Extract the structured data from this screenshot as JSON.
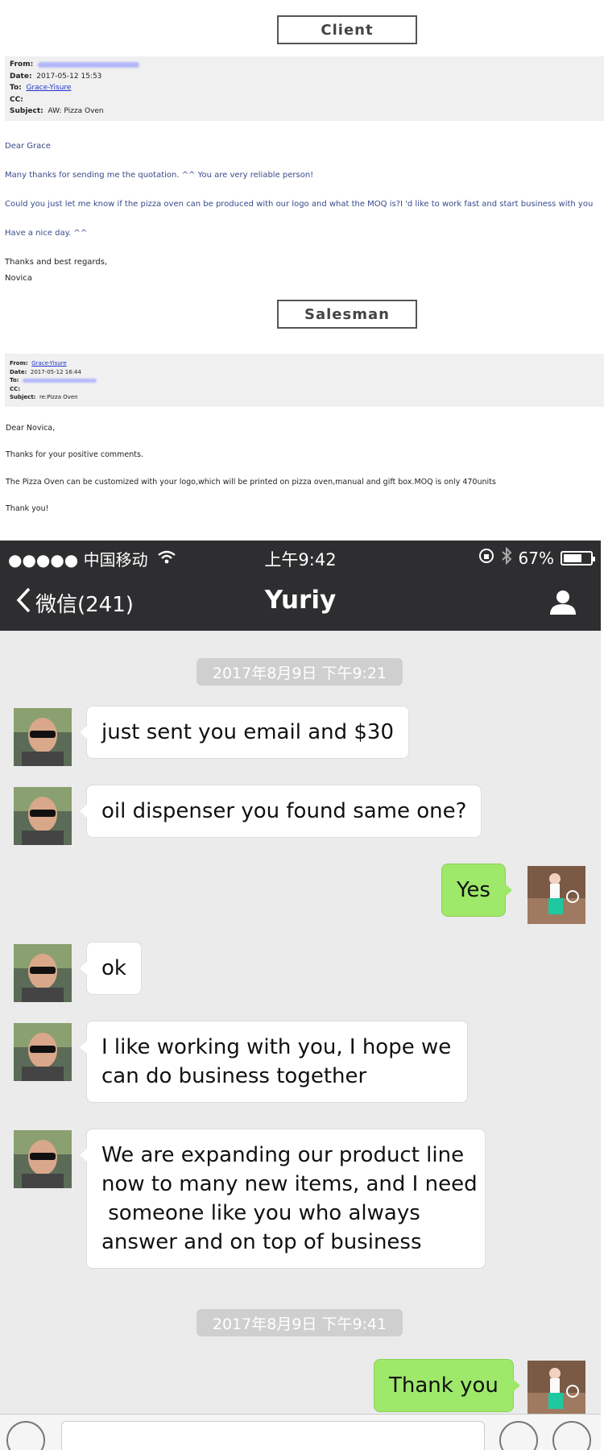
{
  "client_section": {
    "label": "Client",
    "header": {
      "from_label": "From:",
      "date_label": "Date:",
      "date": "2017-05-12 15:53",
      "to_label": "To:",
      "to": "Grace-Yisure",
      "cc_label": "CC:",
      "subject_label": "Subject:",
      "subject": "AW: Pizza Oven"
    },
    "lines": [
      "Dear Grace",
      "Many thanks for sending me the quotation. ^^ You are very reliable person!",
      "Could you just let me know if the pizza oven can be produced with our logo and what the MOQ is?I 'd like to work fast and start business with you",
      "Have a nice day. ^^",
      "Thanks and best regards,",
      "Novica"
    ]
  },
  "salesman_section": {
    "label": "Salesman",
    "header": {
      "from_label": "From:",
      "from": "Grace-Yisure",
      "date_label": "Date:",
      "date": "2017-05-12 16:44",
      "to_label": "To:",
      "cc_label": "CC:",
      "subject_label": "Subject:",
      "subject": "re:Pizza Oven"
    },
    "lines": [
      "Dear Novica,",
      "Thanks for your positive comments.",
      "The Pizza Oven can be customized with your logo,which will be printed on pizza oven,manual and gift box.MOQ is only 470units",
      "Thank you!"
    ]
  },
  "status_bar": {
    "carrier": "●●●●● 中国移动",
    "time": "上午9:42",
    "battery": "67%"
  },
  "nav": {
    "back_label": "微信(241)",
    "title": "Yuriy"
  },
  "chat": {
    "timestamp_1": "2017年8月9日 下午9:21",
    "timestamp_2": "2017年8月9日 下午9:41",
    "msg_1": "just sent you email and $30",
    "msg_2": "oil dispenser you found same one?",
    "msg_3": "Yes",
    "msg_4": "ok",
    "msg_5a": "I like working with you, I hope we",
    "msg_5b": "can do business together",
    "msg_6a": "We are expanding our product line",
    "msg_6b": "now to many new items, and I need",
    "msg_6c": " someone like you who always",
    "msg_6d": "answer and on top of business",
    "msg_7": "Thank you"
  },
  "colors": {
    "nav_bg": "#2e2e30",
    "chat_bg": "#ebebeb",
    "sent_bubble": "#9ee86a",
    "received_bubble": "#ffffff"
  }
}
